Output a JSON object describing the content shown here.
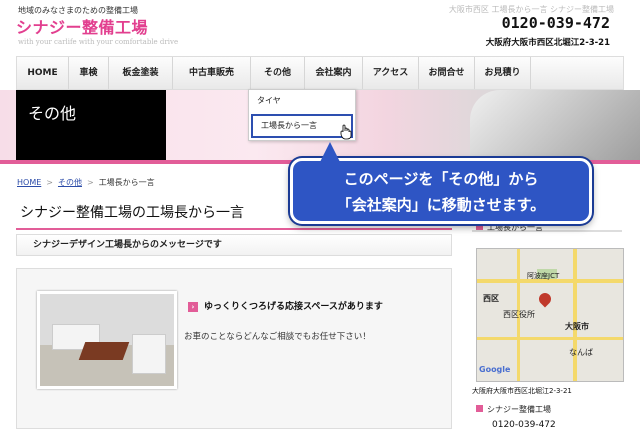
{
  "header": {
    "tagline": "地域のみなさまのための整備工場",
    "logo": "シナジー整備工場",
    "logo_sub": "with your carlife with your comfortable drive",
    "top_right": "大阪市西区 工場長から一言 シナジー整備工場",
    "phone": "0120-039-472",
    "address": "大阪府大阪市西区北堀江2-3-21"
  },
  "nav": {
    "items": [
      "HOME",
      "車検",
      "板金塗装",
      "中古車販売",
      "その他",
      "会社案内",
      "アクセス",
      "お問合せ",
      "お見積り"
    ]
  },
  "dropdown": {
    "items": [
      "タイヤ",
      "工場長から一言"
    ]
  },
  "hero": {
    "title": "その他"
  },
  "breadcrumb": {
    "home": "HOME",
    "parent": "その他",
    "current": "工場長から一言"
  },
  "main": {
    "title": "シナジー整備工場の工場長から一言",
    "subheading": "シナジーデザイン工場長からのメッセージです",
    "msg_head": "ゆっくりくつろげる応接スペースがあります",
    "msg_body": "お車のことならどんなご相談でもお任せ下さい！"
  },
  "sidebar": {
    "item1": "工場長から一言",
    "map_labels": {
      "nishiku": "西区",
      "office": "西区役所",
      "osaka": "大阪市",
      "namba": "なんば",
      "jct": "阿波座JCT",
      "google": "Google"
    },
    "map_address": "大阪府大阪市西区北堀江2-3-21",
    "item2": "シナジー整備工場",
    "phone": "0120-039-472"
  },
  "callout": {
    "line1": "このページを「その他」から",
    "line2": "「会社案内」に移動させます。"
  },
  "colors": {
    "accent": "#e25d98",
    "callout": "#2e55c4",
    "link": "#2b4ba8"
  }
}
